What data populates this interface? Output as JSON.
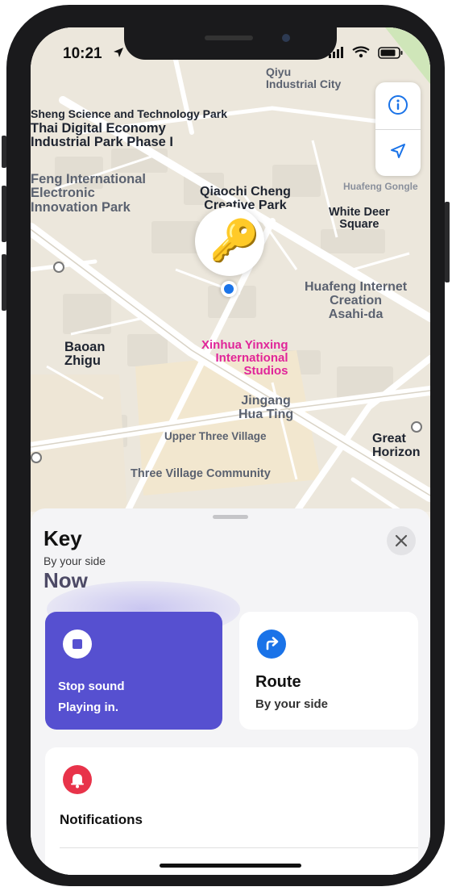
{
  "status_bar": {
    "time": "10:21"
  },
  "map": {
    "labels": {
      "qiyu": "Qiyu\nIndustrial City",
      "sheng": "Sheng Science and Technology Park",
      "thai": "Thai Digital Economy\nIndustrial Park Phase I",
      "feng": "Feng International\nElectronic\nInnovation Park",
      "qiaochi": "Qiaochi Cheng\nCreative Park",
      "huafeng_gongle": "Huafeng Gongle",
      "white_deer": "White Deer\nSquare",
      "huafeng_internet": "Huafeng Internet\nCreation\nAsahi-da",
      "baoan": "Baoan\nZhigu",
      "xinhua": "Xinhua Yinxing\nInternational\nStudios",
      "jingang": "Jingang\nHua Ting",
      "upper_three": "Upper Three Village",
      "great_horizon": "Great\nHorizon",
      "three_village": "Three Village Community"
    }
  },
  "item": {
    "title": "Key",
    "subtitle": "By your side",
    "status": "Now"
  },
  "actions": {
    "stop": {
      "label": "Stop sound",
      "sub": "Playing in."
    },
    "route": {
      "label": "Route",
      "sub": "By your side"
    },
    "notifications": {
      "label": "Notifications"
    }
  },
  "colors": {
    "accent_purple": "#5650d0",
    "route_blue": "#1a73e8",
    "bell_red": "#e8334a",
    "location_blue": "#1a73e8",
    "pink_label": "#e0259a"
  },
  "icons": {
    "info": "info-icon",
    "locate": "location-arrow-icon",
    "close": "close-icon",
    "stop": "stop-icon",
    "route": "route-arrow-icon",
    "bell": "bell-icon",
    "key": "key-icon"
  }
}
